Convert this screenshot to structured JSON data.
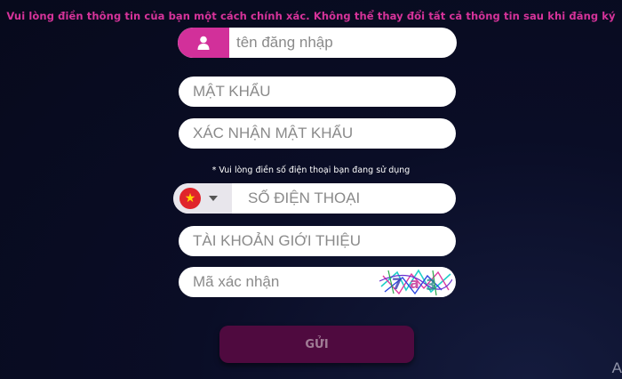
{
  "notice": "Vui lòng điền thông tin của bạn một cách chính xác. Không thể thay đổi tất cả thông tin sau khi đăng ký",
  "form": {
    "username_placeholder": "tên đăng nhập",
    "password_placeholder": "MẬT KHẨU",
    "confirm_password_placeholder": "XÁC NHẬN MẬT KHẨU",
    "phone_hint": "* Vui lòng điền số điện thoại bạn đang sử dụng",
    "phone_placeholder": "SỐ ĐIỆN THOẠI",
    "country_flag": "★",
    "referral_placeholder": "TÀI KHOẢN GIỚI THIỆU",
    "captcha_placeholder": "Mã xác nhận",
    "submit_label": "GỬI"
  },
  "corner_text": "A",
  "colors": {
    "accent": "#d2309a",
    "notice": "#d6339a",
    "submit_bg": "#4f0a3f",
    "background": "#0a0d26",
    "flag_red": "#e0242b",
    "flag_star": "#ffd400"
  },
  "icons": {
    "username": "user-icon",
    "country": "vietnam-flag-icon",
    "dropdown": "caret-down-icon"
  }
}
